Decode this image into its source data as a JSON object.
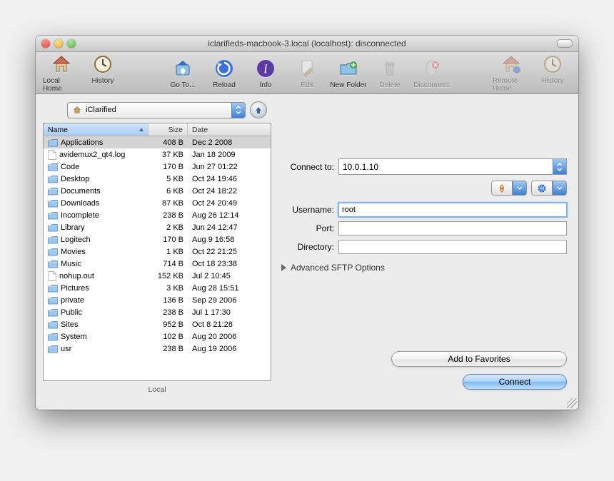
{
  "window": {
    "title": "iclarifieds-macbook-3.local (localhost): disconnected"
  },
  "toolbar": {
    "local_home": "Local Home",
    "history_l": "History",
    "go_to": "Go To...",
    "reload": "Reload",
    "info": "Info",
    "edit": "Edit",
    "new_folder": "New Folder",
    "delete": "Delete",
    "disconnect": "Disconnect",
    "remote_home": "Remote Home",
    "history_r": "History"
  },
  "path_selector": {
    "value": "iClarified"
  },
  "columns": {
    "name": "Name",
    "size": "Size",
    "date": "Date"
  },
  "files": [
    {
      "type": "folder",
      "name": "Applications",
      "size": "408 B",
      "date": "Dec 2 2008",
      "selected": true
    },
    {
      "type": "file",
      "name": "avidemux2_qt4.log",
      "size": "37 KB",
      "date": "Jan 18 2009"
    },
    {
      "type": "folder",
      "name": "Code",
      "size": "170 B",
      "date": "Jun 27 01:22"
    },
    {
      "type": "folder",
      "name": "Desktop",
      "size": "5 KB",
      "date": "Oct 24 19:46"
    },
    {
      "type": "folder",
      "name": "Documents",
      "size": "6 KB",
      "date": "Oct 24 18:22"
    },
    {
      "type": "folder",
      "name": "Downloads",
      "size": "87 KB",
      "date": "Oct 24 20:49"
    },
    {
      "type": "folder",
      "name": "Incomplete",
      "size": "238 B",
      "date": "Aug 26 12:14"
    },
    {
      "type": "folder",
      "name": "Library",
      "size": "2 KB",
      "date": "Jun 24 12:47"
    },
    {
      "type": "folder",
      "name": "Logitech",
      "size": "170 B",
      "date": "Aug 9 16:58"
    },
    {
      "type": "folder",
      "name": "Movies",
      "size": "1 KB",
      "date": "Oct 22 21:25"
    },
    {
      "type": "folder",
      "name": "Music",
      "size": "714 B",
      "date": "Oct 18 23:38"
    },
    {
      "type": "file",
      "name": "nohup.out",
      "size": "152 KB",
      "date": "Jul 2 10:45"
    },
    {
      "type": "folder",
      "name": "Pictures",
      "size": "3 KB",
      "date": "Aug 28 15:51"
    },
    {
      "type": "folder",
      "name": "private",
      "size": "136 B",
      "date": "Sep 29 2006"
    },
    {
      "type": "folder",
      "name": "Public",
      "size": "238 B",
      "date": "Jul 1 17:30"
    },
    {
      "type": "folder",
      "name": "Sites",
      "size": "952 B",
      "date": "Oct 8 21:28"
    },
    {
      "type": "folder",
      "name": "System",
      "size": "102 B",
      "date": "Aug 20 2006"
    },
    {
      "type": "folder",
      "name": "usr",
      "size": "238 B",
      "date": "Aug 19 2006"
    }
  ],
  "local_label": "Local",
  "connect": {
    "connect_to_label": "Connect to:",
    "connect_to_value": "10.0.1.10",
    "username_label": "Username:",
    "username_value": "root",
    "port_label": "Port:",
    "port_value": "",
    "directory_label": "Directory:",
    "directory_value": "",
    "advanced_label": "Advanced SFTP Options",
    "add_favorites": "Add to Favorites",
    "connect_button": "Connect"
  }
}
